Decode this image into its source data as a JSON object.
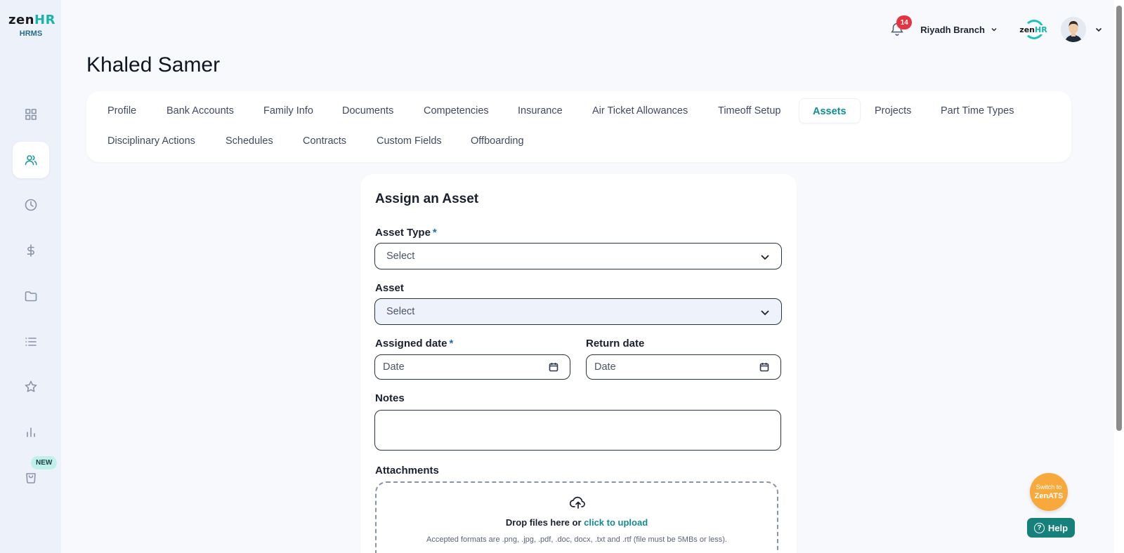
{
  "app": {
    "logo_main": "zen",
    "logo_accent": "HR",
    "logo_sub": "HRMS"
  },
  "sidebar": {
    "items": [
      {
        "icon": "dashboard-icon",
        "active": false
      },
      {
        "icon": "people-icon",
        "active": true
      },
      {
        "icon": "clock-icon",
        "active": false
      },
      {
        "icon": "dollar-icon",
        "active": false
      },
      {
        "icon": "folder-icon",
        "active": false
      },
      {
        "icon": "list-icon",
        "active": false
      },
      {
        "icon": "star-icon",
        "active": false
      },
      {
        "icon": "chart-icon",
        "active": false
      },
      {
        "icon": "bag-icon",
        "active": false
      }
    ],
    "new_badge": "NEW"
  },
  "topbar": {
    "notification_count": "14",
    "branch": "Riyadh Branch",
    "mini_logo_main": "zen",
    "mini_logo_accent": "HR"
  },
  "page": {
    "title": "Khaled Samer"
  },
  "tabs": {
    "row1": [
      "Profile",
      "Bank Accounts",
      "Family Info",
      "Documents",
      "Competencies",
      "Insurance",
      "Air Ticket Allowances",
      "Timeoff Setup",
      "Assets",
      "Projects",
      "Part Time Types"
    ],
    "row2": [
      "Disciplinary Actions",
      "Schedules",
      "Contracts",
      "Custom Fields",
      "Offboarding"
    ],
    "active": "Assets"
  },
  "form": {
    "title": "Assign an Asset",
    "asset_type_label": "Asset Type",
    "asset_type_value": "Select",
    "asset_label": "Asset",
    "asset_value": "Select",
    "assigned_date_label": "Assigned date",
    "assigned_date_placeholder": "Date",
    "return_date_label": "Return date",
    "return_date_placeholder": "Date",
    "notes_label": "Notes",
    "notes_value": "",
    "required_mark": "*",
    "attachments_label": "Attachments",
    "drop_text": "Drop files here or",
    "drop_link": "click to upload",
    "accepted_formats": "Accepted formats are .png, .jpg, .pdf, .doc, docx, .txt and .rtf (file must be 5MBs or less)."
  },
  "floating": {
    "switch_line1": "Switch to",
    "switch_line2": "ZenATS",
    "help": "Help",
    "help_icon": "?"
  },
  "colors": {
    "accent": "#118f93",
    "badge_red": "#e5343f",
    "switch_orange": "#f7a93b",
    "help_green": "#16807a"
  }
}
